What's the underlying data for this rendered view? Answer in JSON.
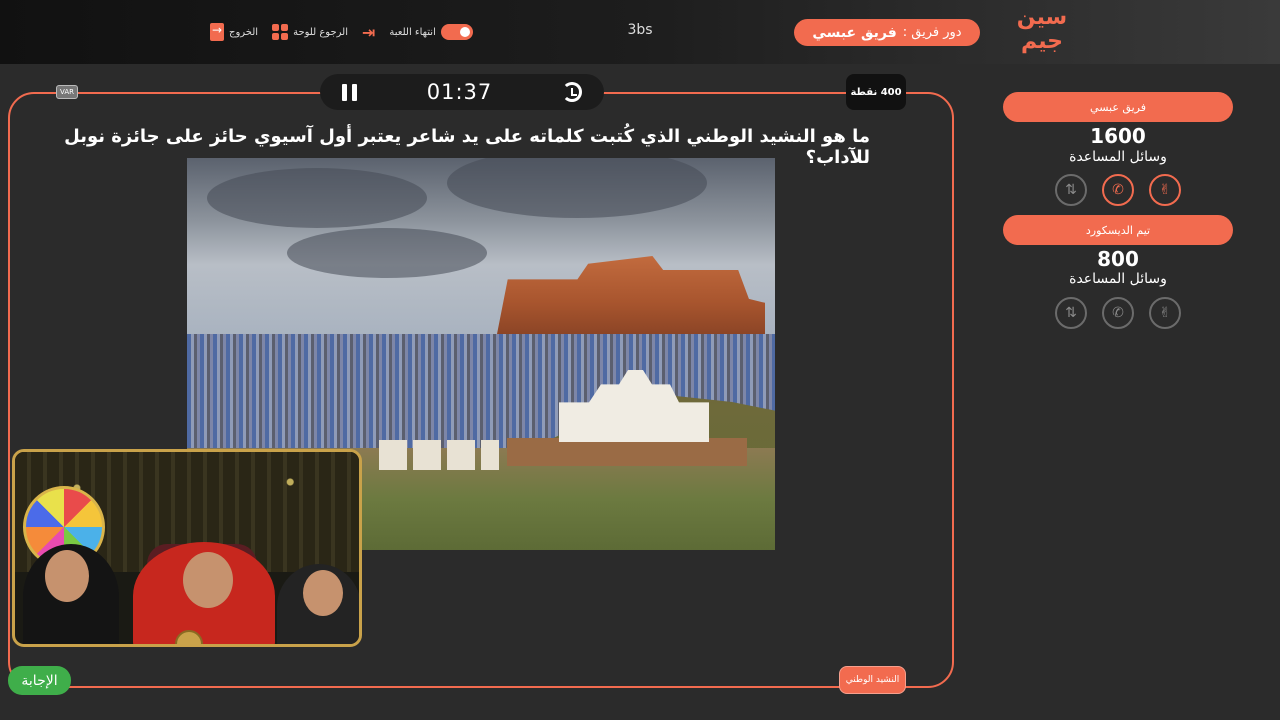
{
  "header": {
    "logo_line1": "سين",
    "logo_line2": "جيم",
    "turn_label": "دور فريق :",
    "turn_team": "فريق عبسي",
    "room_code": "3bs",
    "actions": {
      "end_game": "انتهاء اللعبة",
      "back_to_board": "الرجوع للوحة",
      "exit": "الخروج"
    }
  },
  "question": {
    "timer": "01:37",
    "points": "400 نقطة",
    "var_label": "VAR",
    "text": "ما هو النشيد الوطني الذي كُتبت كلماته على يد شاعر يعتبر أول آسيوي حائز على جائزة نوبل للآداب؟",
    "category": "النشيد الوطني",
    "end_button": "الإجابة"
  },
  "teams": [
    {
      "name": "فريق عبسي",
      "score": "1600",
      "aids_label": "وسائل المساعدة",
      "aids": [
        {
          "icon": "two-fingers-icon",
          "glyph": "✌",
          "active": true
        },
        {
          "icon": "phone-icon",
          "glyph": "✆",
          "active": true
        },
        {
          "icon": "swap-icon",
          "glyph": "⇅",
          "active": false
        }
      ]
    },
    {
      "name": "تيم الديسكورد",
      "score": "800",
      "aids_label": "وسائل المساعدة",
      "aids": [
        {
          "icon": "two-fingers-icon",
          "glyph": "✌",
          "active": false
        },
        {
          "icon": "phone-icon",
          "glyph": "✆",
          "active": false
        },
        {
          "icon": "swap-icon",
          "glyph": "⇅",
          "active": false
        }
      ]
    }
  ],
  "colors": {
    "accent": "#f26b4f",
    "background": "#2b2b2b",
    "end_button": "#3fae4a"
  }
}
